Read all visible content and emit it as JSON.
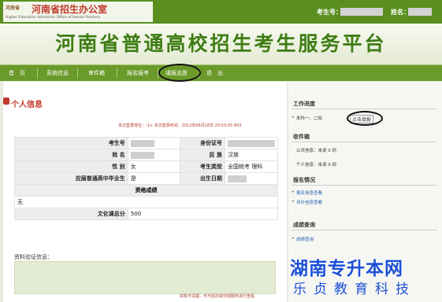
{
  "header": {
    "logo_small": "河南省",
    "logo_title": "河南省招生办公室",
    "logo_sub": "Higher Education Admission Office of Henan Province",
    "candidate_no_label": "考生号：",
    "name_label": "姓名："
  },
  "banner": {
    "title": "河南省普通高校招生考生服务平台"
  },
  "nav": [
    "首　页",
    "系统信息",
    "审件箱",
    "报名报考",
    "填报志愿",
    "退　出"
  ],
  "main": {
    "section_title": "个人信息",
    "login_info": "本次登录地址：:1+ 本次登录时间：2012年06月18日 20:53:05 403",
    "rows": {
      "candidate_no": "考生号",
      "id_no": "身份证号",
      "name": "姓 名",
      "ethnicity_label": "民 族",
      "ethnicity_value": "汉族",
      "gender_label": "性 别",
      "gender_value": "女",
      "exam_type_label": "考生类型",
      "exam_type_value": "全国统考 理科",
      "grad_label": "应届普通高中毕业生",
      "grad_value": "是",
      "birth_label": "出生日期",
      "qualification": "资格成绩",
      "none": "无",
      "total_label": "文化课总分",
      "total_value": "500"
    },
    "verify_label": "资料验证信息：",
    "footer_note": "如有不清楚，可与招办或中招服务进行查看"
  },
  "sidebar": {
    "work_progress": "工作进度",
    "progress_item": "本科一、二批",
    "progress_button": "点击填报",
    "inbox": "收件箱",
    "public_msg": "公共信息：未读 0 封",
    "personal_msg": "个人信息：未读 0 封",
    "reg_status": "报名情况",
    "reg_link1": "报名信息查看",
    "reg_link2": "评价信息查看",
    "score_query": "成绩查询",
    "score_link": "成绩查询"
  },
  "watermark": {
    "line1": "湖南专升本网",
    "line2": "乐贞教育科技"
  }
}
